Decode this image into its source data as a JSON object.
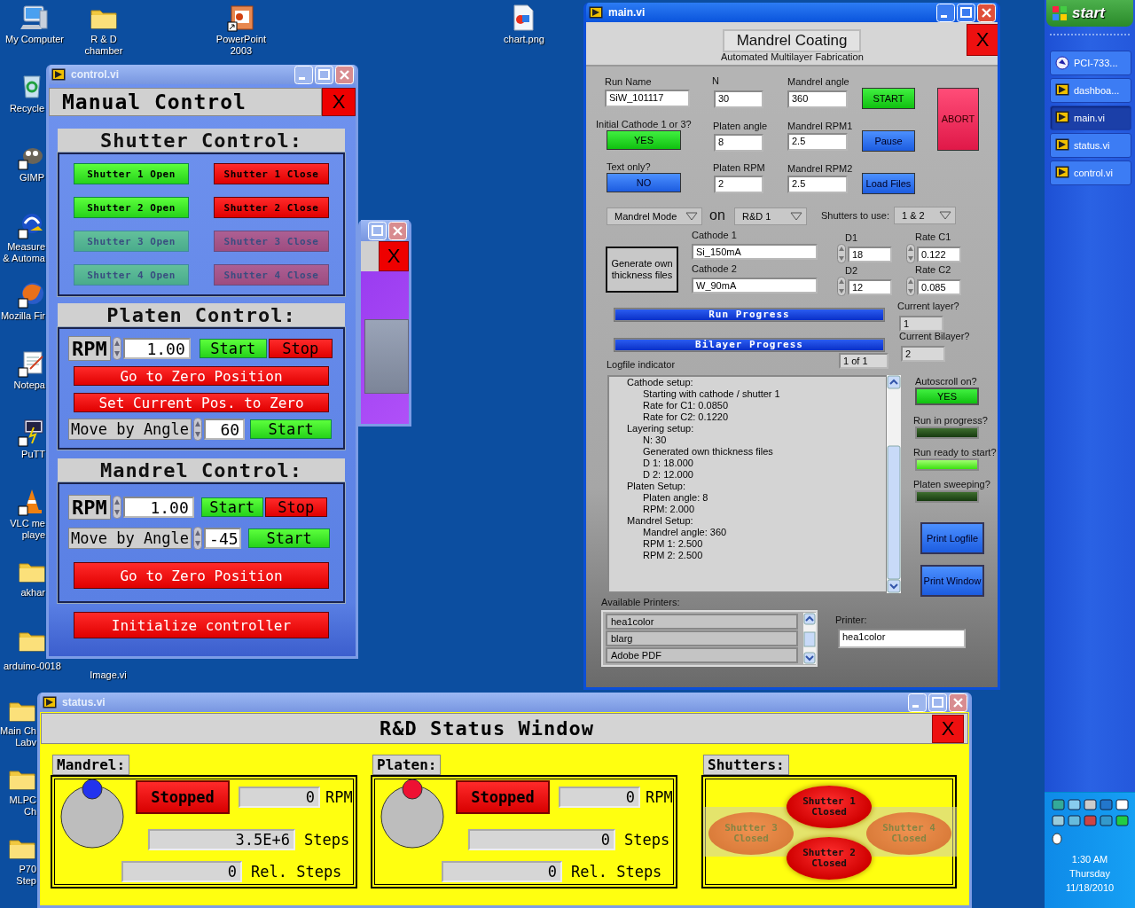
{
  "desktop_icons": [
    {
      "label": "My Computer",
      "kind": "computer"
    },
    {
      "label": "R & D chamber",
      "kind": "folder"
    },
    {
      "label": "PowerPoint 2003",
      "kind": "slides"
    },
    {
      "label": "chart.png",
      "kind": "image"
    },
    {
      "label": "Recycle",
      "kind": "recycle"
    },
    {
      "label": "GIMP",
      "kind": "paint"
    },
    {
      "label": "Measure & Automa",
      "kind": "measure"
    },
    {
      "label": "Mozilla Fir",
      "kind": "browser"
    },
    {
      "label": "Notepa",
      "kind": "notepad"
    },
    {
      "label": "PuTT",
      "kind": "terminal"
    },
    {
      "label": "VLC me playe",
      "kind": "cone"
    },
    {
      "label": "akhar",
      "kind": "folder"
    },
    {
      "label": "arduino-0018",
      "kind": "folder"
    },
    {
      "label": "Image.vi"
    },
    {
      "label": "Main Ch Labv",
      "kind": "folder"
    },
    {
      "label": "MLPC Ch",
      "kind": "folder"
    },
    {
      "label": "P70 Step",
      "kind": "folder"
    }
  ],
  "background_window": {
    "close_button": "X"
  },
  "control_window": {
    "title": "control.vi",
    "heading": "Manual Control",
    "close_button": "X",
    "shutter_section": {
      "title": "Shutter Control:",
      "rows": [
        {
          "open": "Shutter 1 Open",
          "close": "Shutter 1 Close",
          "disabled": false
        },
        {
          "open": "Shutter 2 Open",
          "close": "Shutter 2 Close",
          "disabled": false
        },
        {
          "open": "Shutter 3 Open",
          "close": "Shutter 3 Close",
          "disabled": true
        },
        {
          "open": "Shutter 4 Open",
          "close": "Shutter 4 Close",
          "disabled": true
        }
      ]
    },
    "platen_section": {
      "title": "Platen Control:",
      "rpm_label": "RPM",
      "rpm_value": "1.00",
      "start": "Start",
      "stop": "Stop",
      "zero_button": "Go to Zero Position",
      "set_zero_button": "Set Current Pos. to Zero",
      "move_label": "Move by Angle",
      "move_value": "60",
      "move_start": "Start"
    },
    "mandrel_section": {
      "title": "Mandrel Control:",
      "rpm_label": "RPM",
      "rpm_value": "1.00",
      "start": "Start",
      "stop": "Stop",
      "move_label": "Move by Angle",
      "move_value": "-45",
      "move_start": "Start",
      "zero_button": "Go to Zero Position"
    },
    "init_button": "Initialize controller"
  },
  "main_window": {
    "title": "main.vi",
    "heading": "Mandrel Coating",
    "subheading": "Automated Multilayer Fabrication",
    "close_button": "X",
    "fields": [
      {
        "label": "Run Name",
        "value": "SiW_101117"
      },
      {
        "label": "N",
        "value": "30"
      },
      {
        "label": "Mandrel angle",
        "value": "360"
      },
      {
        "label": "Platen angle",
        "value": "8"
      },
      {
        "label": "Mandrel RPM1",
        "value": "2.5"
      },
      {
        "label": "Platen RPM",
        "value": "2"
      },
      {
        "label": "Mandrel RPM2",
        "value": "2.5"
      }
    ],
    "toggles": [
      {
        "label": "Initial Cathode 1 or 3?",
        "value": "YES",
        "on": true
      },
      {
        "label": "Text only?",
        "value": "NO",
        "on": false
      }
    ],
    "buttons": [
      {
        "label": "START",
        "kind": "go"
      },
      {
        "label": "Pause",
        "kind": "action"
      },
      {
        "label": "Load Files",
        "kind": "action"
      },
      {
        "label": "ABORT",
        "kind": "abort"
      }
    ],
    "mode_select": "Mandrel Mode",
    "on_label": "on",
    "chamber_select": "R&D 1",
    "shutters_label": "Shutters to use:",
    "shutters_select": "1 & 2",
    "generate_button": "Generate own thickness files",
    "cathodes": [
      {
        "label": "Cathode 1",
        "value": "Si_150mA"
      },
      {
        "label": "Cathode 2",
        "value": "W_90mA"
      }
    ],
    "thickness": [
      {
        "label": "D1",
        "value": "18"
      },
      {
        "label": "D2",
        "value": "12"
      }
    ],
    "rates": [
      {
        "label": "Rate C1",
        "value": "0.122"
      },
      {
        "label": "Rate C2",
        "value": "0.085"
      }
    ],
    "progress": [
      {
        "label": "Run Progress",
        "level": 1
      },
      {
        "label": "Bilayer Progress",
        "level": 1
      }
    ],
    "current_layer": {
      "label": "Current layer?",
      "value": "1"
    },
    "current_bilayer": {
      "label": "Current Bilayer?",
      "value": "2"
    },
    "bilayer_count": "1 of 1",
    "log": {
      "label": "Logfile indicator",
      "lines": [
        {
          "text": "Cathode setup:",
          "children": [
            {
              "text": "Starting with cathode / shutter 1"
            },
            {
              "text": "Rate for C1: 0.0850"
            },
            {
              "text": "Rate for C2: 0.1220"
            }
          ]
        },
        {
          "text": "Layering setup:",
          "children": [
            {
              "text": "N: 30"
            },
            {
              "text": "Generated own thickness files"
            },
            {
              "text": "D 1: 18.000"
            },
            {
              "text": "D 2: 12.000"
            }
          ]
        },
        {
          "text": "Platen Setup:",
          "children": [
            {
              "text": "Platen angle: 8"
            },
            {
              "text": "RPM: 2.000"
            }
          ]
        },
        {
          "text": "Mandrel Setup:",
          "children": [
            {
              "text": "Mandrel angle: 360"
            },
            {
              "text": "RPM 1: 2.500"
            },
            {
              "text": "RPM 2: 2.500"
            }
          ]
        }
      ]
    },
    "autoscroll": {
      "label": "Autoscroll on?",
      "value": "YES",
      "on": true
    },
    "indicators": [
      {
        "label": "Run in progress?",
        "on": false
      },
      {
        "label": "Run ready to start?",
        "on": true
      },
      {
        "label": "Platen sweeping?",
        "on": false
      }
    ],
    "print_buttons": [
      "Print Logfile",
      "Print Window"
    ],
    "printers": {
      "label": "Available Printers:",
      "items": [
        "hea1color",
        "blarg",
        "Adobe PDF"
      ]
    },
    "printer": {
      "label": "Printer:",
      "value": "hea1color"
    }
  },
  "status_window": {
    "title": "status.vi",
    "heading": "R&D Status Window",
    "close_button": "X",
    "motors": [
      {
        "name": "Mandrel:",
        "state": "Stopped",
        "rpm": "0",
        "rpm_unit": "RPM",
        "steps": "3.5E+6",
        "steps_unit": "Steps",
        "rel_steps": "0",
        "rel_unit": "Rel. Steps",
        "color": "#2233ee"
      },
      {
        "name": "Platen:",
        "state": "Stopped",
        "rpm": "0",
        "rpm_unit": "RPM",
        "steps": "0",
        "steps_unit": "Steps",
        "rel_steps": "0",
        "rel_unit": "Rel. Steps",
        "color": "#ee1133"
      }
    ],
    "shutters": {
      "title": "Shutters:",
      "items": [
        {
          "name": "Shutter 1",
          "state": "Closed",
          "disabled": false
        },
        {
          "name": "Shutter 2",
          "state": "Closed",
          "disabled": false
        },
        {
          "name": "Shutter 3",
          "state": "Closed",
          "disabled": true
        },
        {
          "name": "Shutter 4",
          "state": "Closed",
          "disabled": true
        }
      ]
    }
  },
  "taskbar": {
    "start": "start",
    "tasks": [
      {
        "label": "PCI-733...",
        "kind": "app",
        "selected": false
      },
      {
        "label": "dashboa...",
        "kind": "vi",
        "selected": false
      },
      {
        "label": "main.vi",
        "kind": "vi",
        "selected": true
      },
      {
        "label": "status.vi",
        "kind": "vi",
        "selected": false
      },
      {
        "label": "control.vi",
        "kind": "vi",
        "selected": false
      }
    ],
    "clock": {
      "time": "1:30 AM",
      "day": "Thursday",
      "date": "11/18/2010"
    }
  }
}
